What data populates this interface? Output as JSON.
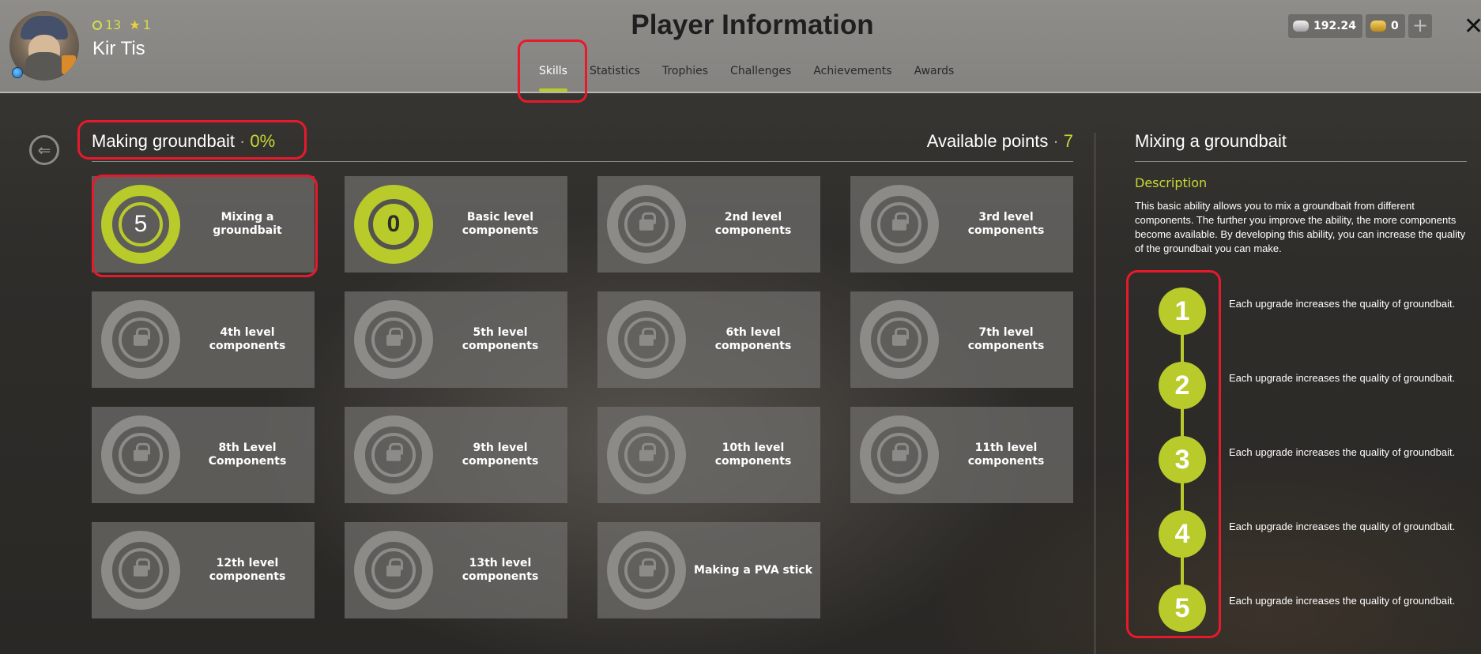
{
  "header": {
    "title": "Player Information",
    "player_name": "Kir Tis",
    "level": "13",
    "rank": "1",
    "silver": "192.24",
    "gold": "0",
    "tabs": [
      {
        "label": "Skills",
        "active": true
      },
      {
        "label": "Statistics",
        "active": false
      },
      {
        "label": "Trophies",
        "active": false
      },
      {
        "label": "Challenges",
        "active": false
      },
      {
        "label": "Achievements",
        "active": false
      },
      {
        "label": "Awards",
        "active": false
      }
    ]
  },
  "skills": {
    "section_title": "Making groundbait",
    "progress": "0%",
    "available_label": "Available points",
    "available_points": "7",
    "cards": [
      {
        "label": "Mixing a groundbait",
        "value": "5",
        "state": "active"
      },
      {
        "label": "Basic level components",
        "value": "0",
        "state": "unlocked"
      },
      {
        "label": "2nd level components",
        "state": "locked"
      },
      {
        "label": "3rd level components",
        "state": "locked"
      },
      {
        "label": "4th level components",
        "state": "locked"
      },
      {
        "label": "5th level components",
        "state": "locked"
      },
      {
        "label": "6th level components",
        "state": "locked"
      },
      {
        "label": "7th level components",
        "state": "locked"
      },
      {
        "label": "8th Level Components",
        "state": "locked"
      },
      {
        "label": "9th level components",
        "state": "locked"
      },
      {
        "label": "10th level components",
        "state": "locked"
      },
      {
        "label": "11th level components",
        "state": "locked"
      },
      {
        "label": "12th level components",
        "state": "locked"
      },
      {
        "label": "13th level components",
        "state": "locked"
      },
      {
        "label": "Making a PVA stick",
        "state": "locked"
      }
    ]
  },
  "detail": {
    "title": "Mixing a groundbait",
    "description_label": "Description",
    "description": "This basic ability allows you to mix a groundbait from different components. The further you improve the ability, the more components become available. By developing this ability, you can increase the quality of the groundbait you can make.",
    "steps": [
      {
        "num": "1",
        "text": "Each upgrade increases the quality of groundbait."
      },
      {
        "num": "2",
        "text": "Each upgrade increases the quality of groundbait."
      },
      {
        "num": "3",
        "text": "Each upgrade increases the quality of groundbait."
      },
      {
        "num": "4",
        "text": "Each upgrade increases the quality of groundbait."
      },
      {
        "num": "5",
        "text": "Each upgrade increases the quality of groundbait."
      }
    ]
  },
  "colors": {
    "accent": "#b8cb2b",
    "highlight": "#e8192c"
  },
  "icons": {
    "level": "ring-icon",
    "rank": "star-icon",
    "silver": "silver-coin-icon",
    "gold": "gold-coin-icon",
    "locked": "lock-icon",
    "back": "back-arrow-icon",
    "close": "close-icon",
    "region": "globe-icon"
  }
}
